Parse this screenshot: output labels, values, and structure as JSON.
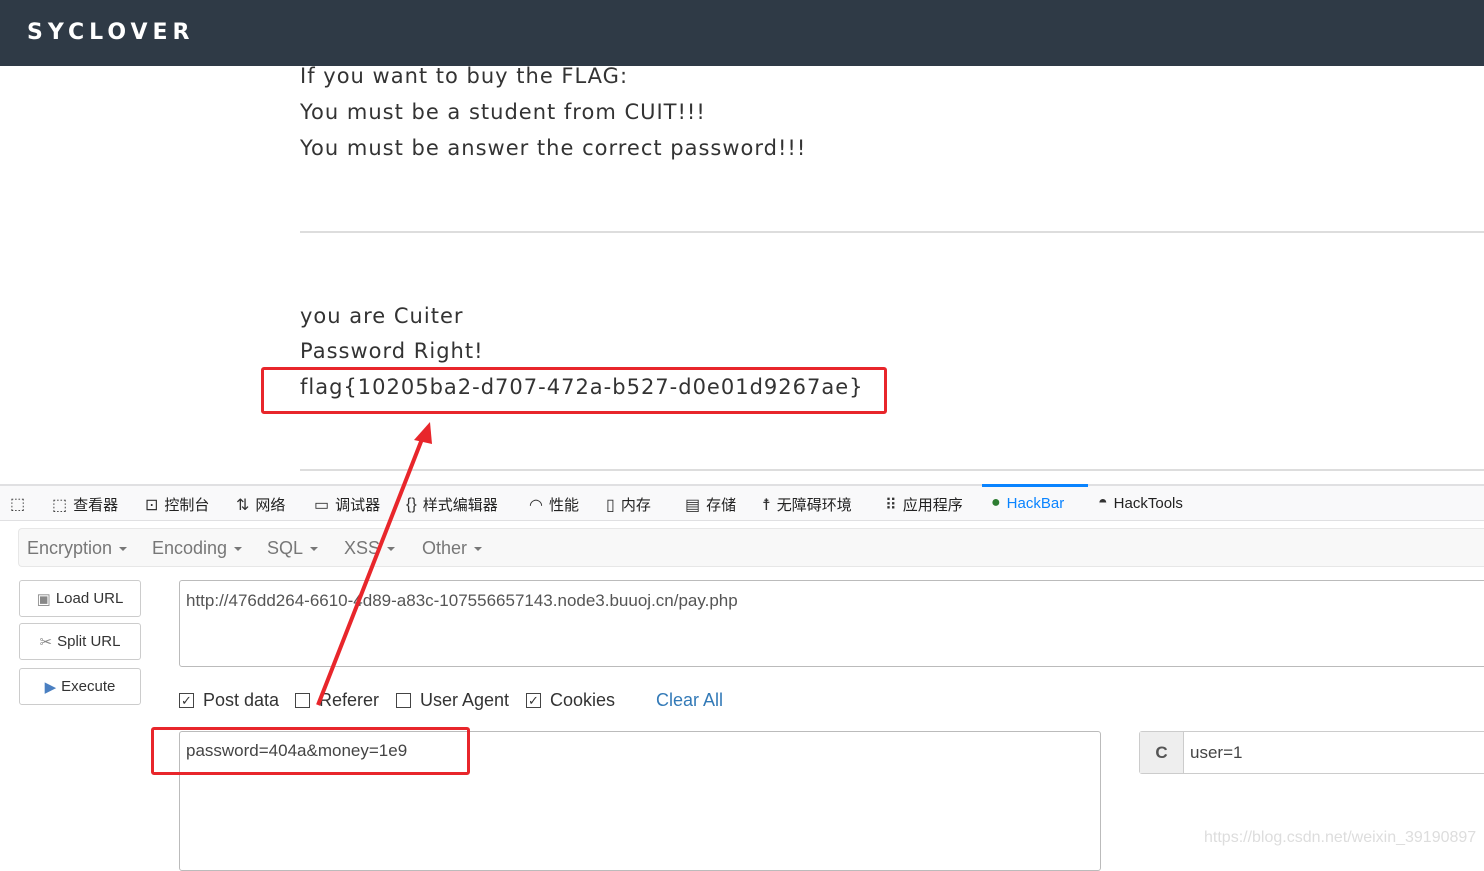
{
  "header": {
    "logo": "SYCLOVER"
  },
  "page": {
    "lines": [
      "If you want to buy the FLAG:",
      "You must be a student from CUIT!!!",
      "You must be answer the correct password!!!"
    ],
    "result": [
      "you are Cuiter",
      "Password Right!",
      "flag{10205ba2-d707-472a-b527-d0e01d9267ae}"
    ]
  },
  "devtools": {
    "tabs": [
      {
        "label": "查看器",
        "icon": "inspector-icon"
      },
      {
        "label": "控制台",
        "icon": "console-icon"
      },
      {
        "label": "网络",
        "icon": "network-icon"
      },
      {
        "label": "调试器",
        "icon": "debugger-icon"
      },
      {
        "label": "样式编辑器",
        "icon": "style-editor-icon"
      },
      {
        "label": "性能",
        "icon": "performance-icon"
      },
      {
        "label": "内存",
        "icon": "memory-icon"
      },
      {
        "label": "存储",
        "icon": "storage-icon"
      },
      {
        "label": "无障碍环境",
        "icon": "accessibility-icon"
      },
      {
        "label": "应用程序",
        "icon": "application-icon"
      },
      {
        "label": "HackBar",
        "icon": "hackbar-icon",
        "active": true
      },
      {
        "label": "HackTools",
        "icon": "hacktools-icon"
      }
    ],
    "accent": "#0a84ff"
  },
  "hackbar": {
    "menus": [
      "Encryption",
      "Encoding",
      "SQL",
      "XSS",
      "Other"
    ],
    "buttons": {
      "load": "Load URL",
      "split": "Split URL",
      "execute": "Execute"
    },
    "url": "http://476dd264-6610-4d89-a83c-107556657143.node3.buuoj.cn/pay.php",
    "options": [
      {
        "label": "Post data",
        "checked": true
      },
      {
        "label": "Referer",
        "checked": false
      },
      {
        "label": "User Agent",
        "checked": false
      },
      {
        "label": "Cookies",
        "checked": true
      }
    ],
    "clear_all": "Clear All",
    "post_data": "password=404a&money=1e9",
    "cookie_label": "C",
    "cookie_value": "user=1"
  },
  "watermark": "https://blog.csdn.net/weixin_39190897",
  "annotation_color": "#e8262b"
}
